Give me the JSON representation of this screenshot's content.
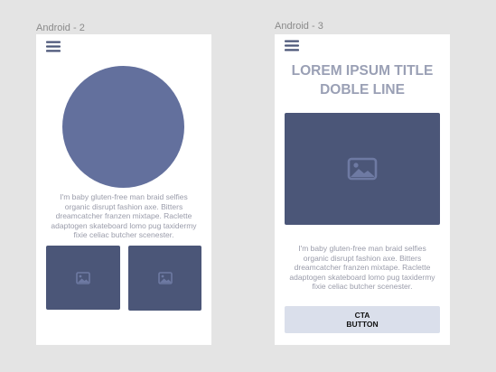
{
  "canvas": {
    "background": "#e4e4e4"
  },
  "frames": [
    {
      "label": "Android - 2",
      "icons": [
        "hamburger-menu-icon",
        "image-placeholder-icon"
      ],
      "colors": {
        "circle": "#63709d",
        "thumbnail": "#4b5678",
        "text": "#9a9caa"
      },
      "body_text": "I'm baby gluten-free man braid selfies organic disrupt fashion axe. Bitters dreamcatcher franzen mixtape. Raclette adaptogen skateboard lomo pug taxidermy fixie celiac butcher scenester."
    },
    {
      "label": "Android - 3",
      "icons": [
        "hamburger-menu-icon",
        "image-placeholder-icon"
      ],
      "colors": {
        "title": "#9aa0b5",
        "hero": "#4b5678",
        "cta_background": "#dadfeb"
      },
      "title": "LOREM IPSUM TITLE DOBLE LINE",
      "body_text": "I'm baby gluten-free man braid selfies organic disrupt fashion axe. Bitters dreamcatcher franzen mixtape. Raclette adaptogen skateboard lomo pug taxidermy fixie celiac butcher scenester.",
      "cta_label": "CTA\nBUTTON"
    }
  ]
}
